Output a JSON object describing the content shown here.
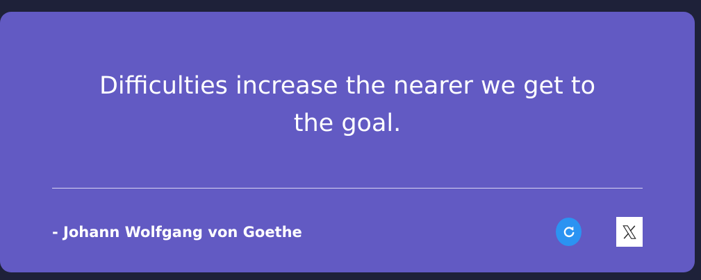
{
  "quote": {
    "text": "Difficulties increase the nearer we get to the goal.",
    "author": "- Johann Wolfgang von Goethe"
  },
  "actions": {
    "refresh_icon": "refresh-icon",
    "share_icon": "x-logo-icon"
  },
  "colors": {
    "background": "#1e2139",
    "card": "#625ac3",
    "refresh_button": "#2b93f2",
    "text": "#ffffff"
  }
}
